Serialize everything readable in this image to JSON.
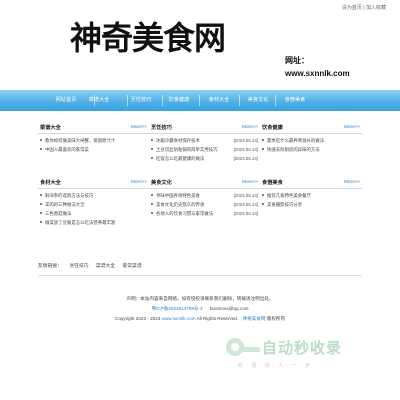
{
  "top_links": {
    "home": "设为首页",
    "sep": "|",
    "favorite": "加入收藏"
  },
  "logo_text": "神奇美食网",
  "site_url": {
    "label": "网址：",
    "value": "www.sxnnlk.com"
  },
  "nav": [
    "网站首页",
    "菜谱大全",
    "烹饪技巧",
    "饮食健康",
    "食材大全",
    "美食文化",
    "食宿美食"
  ],
  "more_label": "More>>",
  "boxes": {
    "recipes": {
      "title": "菜谱大全",
      "items": [
        "教你如何做美味大闸蟹，保留原汁汁",
        "中国人最喜欢的家常菜"
      ]
    },
    "skills": {
      "title": "烹饪技巧",
      "items": [
        {
          "text": "冰箱冷藏食材保存技术",
          "date": "[2023.05.14]"
        },
        {
          "text": "土豆切丝防粘锅的简单实用技巧",
          "date": "[2023.05.14]"
        },
        {
          "text": "吃饭怎么吃最健康的做法",
          "date": "[2023.05.14]"
        }
      ]
    },
    "health": {
      "title": "饮食健康",
      "items": [
        "夏季吃什么最养胃滋补的做法",
        "快速去除厨房的异味的方法"
      ]
    },
    "ingredients": {
      "title": "食材大全",
      "items": [
        "鲜海参的选购方法与技巧",
        "羊肉的三种做法大全",
        "三色香菇做法",
        "做菜放了豆腐是怎么吃法营养最丰富"
      ]
    },
    "culture": {
      "title": "美食文化",
      "items": [
        {
          "text": "寻味中国各地特色美食",
          "date": "[2023.05.14]"
        },
        {
          "text": "美食文化历史悠久的传承",
          "date": "[2023.05.14]"
        },
        {
          "text": "各地人的饮食习惯与家常做法",
          "date": "[2023.05.14]"
        }
      ]
    },
    "food": {
      "title": "食宿美食",
      "items": [
        "推荐几家特色美食餐厅",
        "美食摄影技巧分享"
      ]
    }
  },
  "links_row": [
    "友情链接：",
    "烹饪技巧",
    "菜谱大全",
    "家常菜谱"
  ],
  "footer": {
    "line1": "声明：本站内容来自网络，如有侵权请联系我们删除，转载请注明出处。",
    "icp": "粤ICP备2023014759号-3",
    "contact": "boomnox@qq.com",
    "line3_pre": "Copyright 2023 - 2023 ",
    "line3_site": "www.sxnnlk.com",
    "line3_post": " All Rights Reserved.",
    "line3_link": "神奇美食网",
    "line3_tail": " 版权所有"
  },
  "watermark": {
    "text": "自动秒收录",
    "sub": "收 · 录 · 快 · 人 · 一 · 步"
  }
}
